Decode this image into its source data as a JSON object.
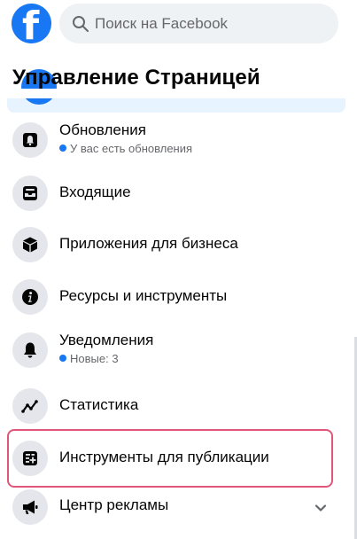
{
  "header": {
    "logo_letter": "f",
    "search": {
      "placeholder": "Поиск на Facebook",
      "icon": "search-icon"
    }
  },
  "page_title": "Управление Страницей",
  "menu": {
    "items": [
      {
        "label": "Обновления",
        "sub": "У вас есть обновления",
        "icon": "bell-box-icon"
      },
      {
        "label": "Входящие",
        "icon": "inbox-icon"
      },
      {
        "label": "Приложения для бизнеса",
        "icon": "cube-icon"
      },
      {
        "label": "Ресурсы и инструменты",
        "icon": "info-icon"
      },
      {
        "label": "Уведомления",
        "sub": "Новые: 3",
        "icon": "bell-icon"
      },
      {
        "label": "Статистика",
        "icon": "line-chart-icon"
      },
      {
        "label": "Инструменты для публикации",
        "icon": "publishing-tools-icon",
        "selected": true
      },
      {
        "label": "Центр рекламы",
        "icon": "megaphone-icon",
        "expandable": true
      }
    ]
  },
  "colors": {
    "brand": "#1877f2",
    "selected_outline": "#e0567a",
    "icon_bg": "#e4e6eb",
    "secondary_text": "#65676b"
  }
}
